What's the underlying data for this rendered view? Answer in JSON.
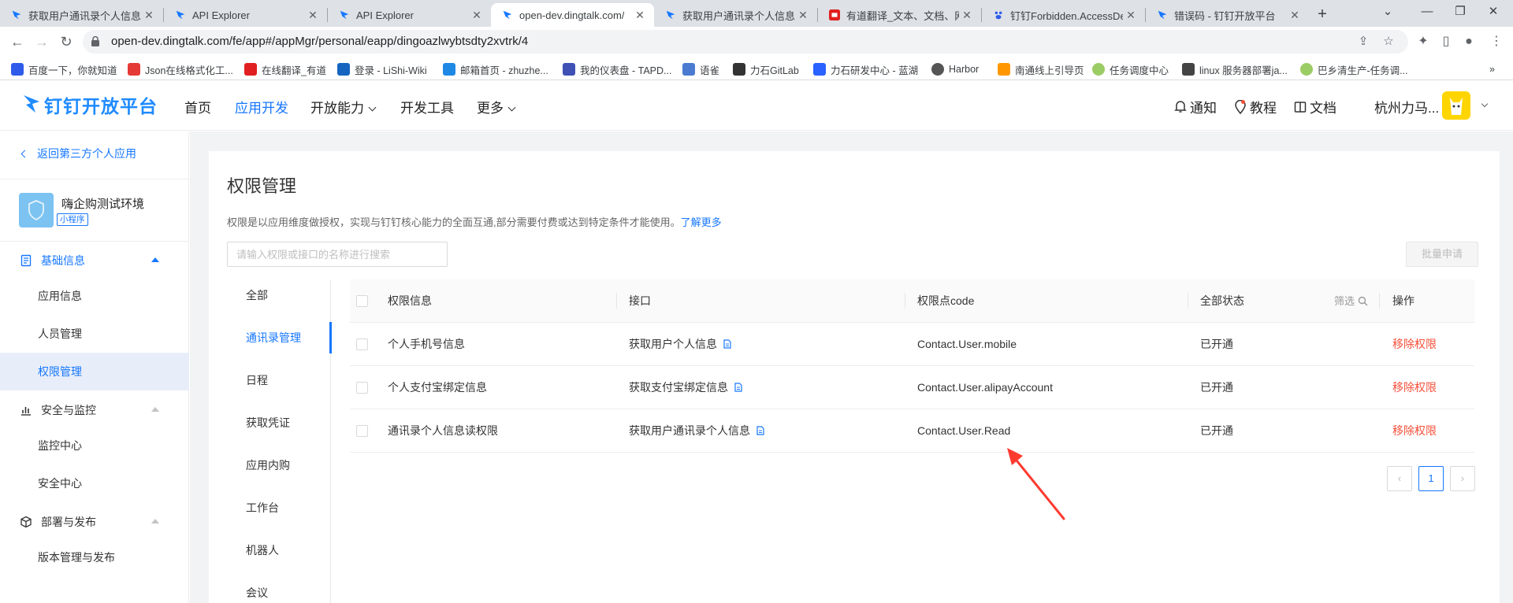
{
  "browser": {
    "tabs": [
      {
        "title": "获取用户通讯录个人信息 -",
        "active": false
      },
      {
        "title": "API Explorer",
        "active": false
      },
      {
        "title": "API Explorer",
        "active": false
      },
      {
        "title": "open-dev.dingtalk.com/",
        "active": true
      },
      {
        "title": "获取用户通讯录个人信息 -",
        "active": false
      },
      {
        "title": "有道翻译_文本、文档、网",
        "active": false
      },
      {
        "title": "钉钉Forbidden.AccessDe",
        "active": false
      },
      {
        "title": "错误码 - 钉钉开放平台",
        "active": false
      }
    ],
    "new_tab": "+",
    "url": "open-dev.dingtalk.com/fe/app#/appMgr/personal/eapp/dingoazlwybtsdty2xvtrk/4",
    "bookmarks": [
      {
        "label": "百度一下，你就知道",
        "color": "#2f5bea"
      },
      {
        "label": "Json在线格式化工...",
        "color": "#e53935"
      },
      {
        "label": "在线翻译_有道",
        "color": "#e02020"
      },
      {
        "label": "登录 - LiShi-Wiki",
        "color": "#1565c0"
      },
      {
        "label": "邮箱首页 - zhuzhe...",
        "color": "#1e88e5"
      },
      {
        "label": "我的仪表盘 - TAPD...",
        "color": "#3f51b5"
      },
      {
        "label": "语雀",
        "color": "#4a7bd0"
      },
      {
        "label": "力石GitLab",
        "color": "#333333"
      },
      {
        "label": "力石研发中心 - 蓝湖",
        "color": "#2962ff"
      },
      {
        "label": "Harbor",
        "color": "#555555"
      },
      {
        "label": "南通线上引导页",
        "color": "#ff9800"
      },
      {
        "label": "任务调度中心",
        "color": "#9ccc65"
      },
      {
        "label": "linux 服务器部署ja...",
        "color": "#444444"
      },
      {
        "label": "巴乡清生产-任务调...",
        "color": "#9ccc65"
      }
    ],
    "bookmarks_more": "»"
  },
  "header": {
    "logo_text": "钉钉开放平台",
    "nav": [
      {
        "label": "首页",
        "active": false,
        "dropdown": false
      },
      {
        "label": "应用开发",
        "active": true,
        "dropdown": false
      },
      {
        "label": "开放能力",
        "active": false,
        "dropdown": true
      },
      {
        "label": "开发工具",
        "active": false,
        "dropdown": false
      },
      {
        "label": "更多",
        "active": false,
        "dropdown": true
      }
    ],
    "notify_label": "通知",
    "tutorial_label": "教程",
    "docs_label": "文档",
    "org_name": "杭州力马..."
  },
  "sidebar": {
    "back_label": "返回第三方个人应用",
    "app_name": "嗨企购测试环境",
    "app_badge": "小程序",
    "groups": [
      {
        "label": "基础信息",
        "expanded": true,
        "items": [
          "应用信息",
          "人员管理",
          "权限管理"
        ]
      },
      {
        "label": "安全与监控",
        "expanded": true,
        "items": [
          "监控中心",
          "安全中心"
        ]
      },
      {
        "label": "部署与发布",
        "expanded": true,
        "items": [
          "版本管理与发布"
        ]
      }
    ],
    "active_item": "权限管理"
  },
  "main": {
    "title": "权限管理",
    "description": "权限是以应用维度做授权，实现与钉钉核心能力的全面互通,部分需要付费或达到特定条件才能使用。",
    "learn_more": "了解更多",
    "search_placeholder": "请输入权限或接口的名称进行搜索",
    "batch_button": "批量申请",
    "categories": [
      "全部",
      "通讯录管理",
      "日程",
      "获取凭证",
      "应用内购",
      "工作台",
      "机器人",
      "会议"
    ],
    "active_category": "通讯录管理",
    "table": {
      "headers": [
        "权限信息",
        "接口",
        "权限点code",
        "全部状态",
        "操作"
      ],
      "filter_label": "筛选",
      "rows": [
        {
          "permission": "个人手机号信息",
          "api": "获取用户个人信息",
          "code": "Contact.User.mobile",
          "status": "已开通",
          "action": "移除权限"
        },
        {
          "permission": "个人支付宝绑定信息",
          "api": "获取支付宝绑定信息",
          "code": "Contact.User.alipayAccount",
          "status": "已开通",
          "action": "移除权限"
        },
        {
          "permission": "通讯录个人信息读权限",
          "api": "获取用户通讯录个人信息",
          "code": "Contact.User.Read",
          "status": "已开通",
          "action": "移除权限"
        }
      ]
    },
    "pagination": {
      "prev": "‹",
      "current": "1",
      "next": "›"
    }
  },
  "colors": {
    "accent": "#1677ff",
    "danger": "#f5503a",
    "annotation": "#ff3b30"
  }
}
